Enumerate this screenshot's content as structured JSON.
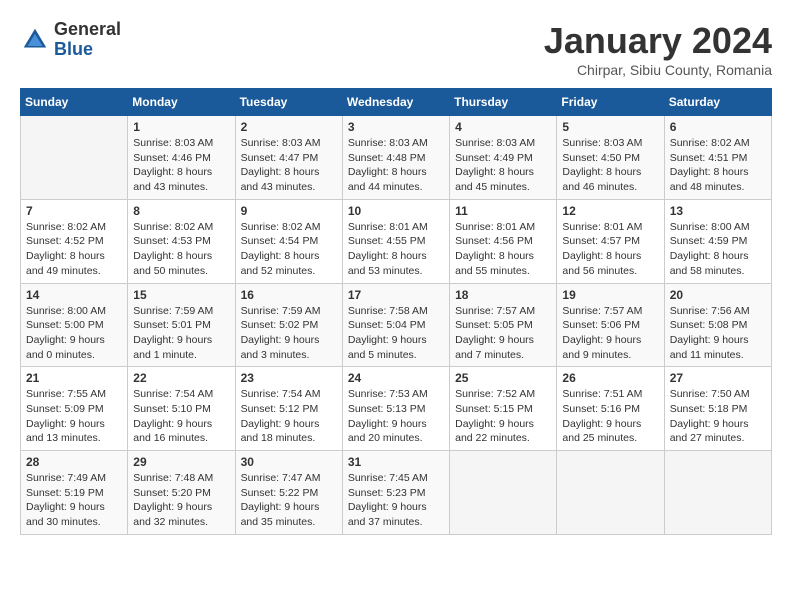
{
  "header": {
    "logo_general": "General",
    "logo_blue": "Blue",
    "month": "January 2024",
    "location": "Chirpar, Sibiu County, Romania"
  },
  "days_of_week": [
    "Sunday",
    "Monday",
    "Tuesday",
    "Wednesday",
    "Thursday",
    "Friday",
    "Saturday"
  ],
  "weeks": [
    [
      {
        "day": "",
        "info": ""
      },
      {
        "day": "1",
        "info": "Sunrise: 8:03 AM\nSunset: 4:46 PM\nDaylight: 8 hours\nand 43 minutes."
      },
      {
        "day": "2",
        "info": "Sunrise: 8:03 AM\nSunset: 4:47 PM\nDaylight: 8 hours\nand 43 minutes."
      },
      {
        "day": "3",
        "info": "Sunrise: 8:03 AM\nSunset: 4:48 PM\nDaylight: 8 hours\nand 44 minutes."
      },
      {
        "day": "4",
        "info": "Sunrise: 8:03 AM\nSunset: 4:49 PM\nDaylight: 8 hours\nand 45 minutes."
      },
      {
        "day": "5",
        "info": "Sunrise: 8:03 AM\nSunset: 4:50 PM\nDaylight: 8 hours\nand 46 minutes."
      },
      {
        "day": "6",
        "info": "Sunrise: 8:02 AM\nSunset: 4:51 PM\nDaylight: 8 hours\nand 48 minutes."
      }
    ],
    [
      {
        "day": "7",
        "info": "Sunrise: 8:02 AM\nSunset: 4:52 PM\nDaylight: 8 hours\nand 49 minutes."
      },
      {
        "day": "8",
        "info": "Sunrise: 8:02 AM\nSunset: 4:53 PM\nDaylight: 8 hours\nand 50 minutes."
      },
      {
        "day": "9",
        "info": "Sunrise: 8:02 AM\nSunset: 4:54 PM\nDaylight: 8 hours\nand 52 minutes."
      },
      {
        "day": "10",
        "info": "Sunrise: 8:01 AM\nSunset: 4:55 PM\nDaylight: 8 hours\nand 53 minutes."
      },
      {
        "day": "11",
        "info": "Sunrise: 8:01 AM\nSunset: 4:56 PM\nDaylight: 8 hours\nand 55 minutes."
      },
      {
        "day": "12",
        "info": "Sunrise: 8:01 AM\nSunset: 4:57 PM\nDaylight: 8 hours\nand 56 minutes."
      },
      {
        "day": "13",
        "info": "Sunrise: 8:00 AM\nSunset: 4:59 PM\nDaylight: 8 hours\nand 58 minutes."
      }
    ],
    [
      {
        "day": "14",
        "info": "Sunrise: 8:00 AM\nSunset: 5:00 PM\nDaylight: 9 hours\nand 0 minutes."
      },
      {
        "day": "15",
        "info": "Sunrise: 7:59 AM\nSunset: 5:01 PM\nDaylight: 9 hours\nand 1 minute."
      },
      {
        "day": "16",
        "info": "Sunrise: 7:59 AM\nSunset: 5:02 PM\nDaylight: 9 hours\nand 3 minutes."
      },
      {
        "day": "17",
        "info": "Sunrise: 7:58 AM\nSunset: 5:04 PM\nDaylight: 9 hours\nand 5 minutes."
      },
      {
        "day": "18",
        "info": "Sunrise: 7:57 AM\nSunset: 5:05 PM\nDaylight: 9 hours\nand 7 minutes."
      },
      {
        "day": "19",
        "info": "Sunrise: 7:57 AM\nSunset: 5:06 PM\nDaylight: 9 hours\nand 9 minutes."
      },
      {
        "day": "20",
        "info": "Sunrise: 7:56 AM\nSunset: 5:08 PM\nDaylight: 9 hours\nand 11 minutes."
      }
    ],
    [
      {
        "day": "21",
        "info": "Sunrise: 7:55 AM\nSunset: 5:09 PM\nDaylight: 9 hours\nand 13 minutes."
      },
      {
        "day": "22",
        "info": "Sunrise: 7:54 AM\nSunset: 5:10 PM\nDaylight: 9 hours\nand 16 minutes."
      },
      {
        "day": "23",
        "info": "Sunrise: 7:54 AM\nSunset: 5:12 PM\nDaylight: 9 hours\nand 18 minutes."
      },
      {
        "day": "24",
        "info": "Sunrise: 7:53 AM\nSunset: 5:13 PM\nDaylight: 9 hours\nand 20 minutes."
      },
      {
        "day": "25",
        "info": "Sunrise: 7:52 AM\nSunset: 5:15 PM\nDaylight: 9 hours\nand 22 minutes."
      },
      {
        "day": "26",
        "info": "Sunrise: 7:51 AM\nSunset: 5:16 PM\nDaylight: 9 hours\nand 25 minutes."
      },
      {
        "day": "27",
        "info": "Sunrise: 7:50 AM\nSunset: 5:18 PM\nDaylight: 9 hours\nand 27 minutes."
      }
    ],
    [
      {
        "day": "28",
        "info": "Sunrise: 7:49 AM\nSunset: 5:19 PM\nDaylight: 9 hours\nand 30 minutes."
      },
      {
        "day": "29",
        "info": "Sunrise: 7:48 AM\nSunset: 5:20 PM\nDaylight: 9 hours\nand 32 minutes."
      },
      {
        "day": "30",
        "info": "Sunrise: 7:47 AM\nSunset: 5:22 PM\nDaylight: 9 hours\nand 35 minutes."
      },
      {
        "day": "31",
        "info": "Sunrise: 7:45 AM\nSunset: 5:23 PM\nDaylight: 9 hours\nand 37 minutes."
      },
      {
        "day": "",
        "info": ""
      },
      {
        "day": "",
        "info": ""
      },
      {
        "day": "",
        "info": ""
      }
    ]
  ]
}
